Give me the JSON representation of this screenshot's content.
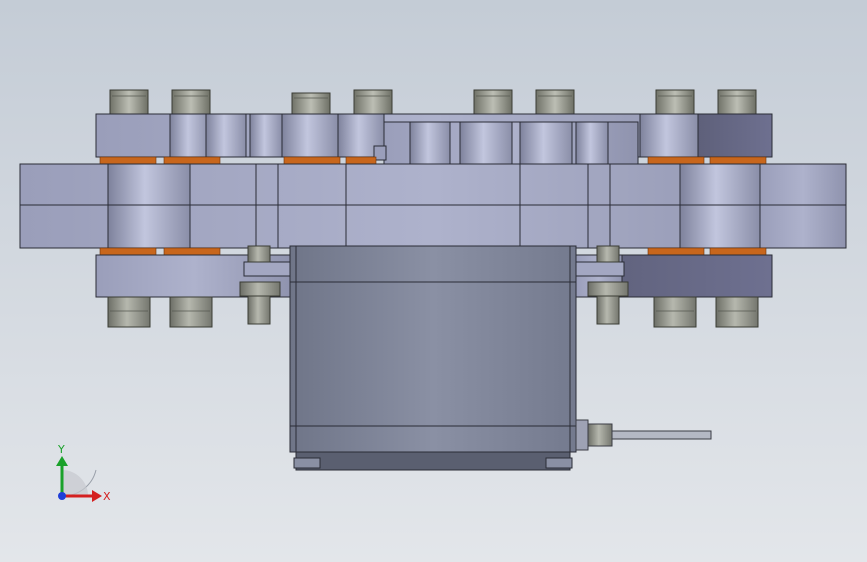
{
  "viewport": {
    "background_top": "#c4ccd6",
    "background_bottom": "#e3e6ea"
  },
  "triad": {
    "x_label": "X",
    "y_label": "Y",
    "x_color": "#d42020",
    "y_color": "#1aa12a",
    "z_color": "#1f3fd8"
  },
  "model": {
    "description_icon": "cad-assembly-icon",
    "colors": {
      "plate": "#a6aac6",
      "plate_dark": "#7a7d9a",
      "bearing": "#c8661c",
      "nut": "#8a8c84",
      "motor": "#7d8397",
      "edge": "#2a2c36"
    }
  }
}
